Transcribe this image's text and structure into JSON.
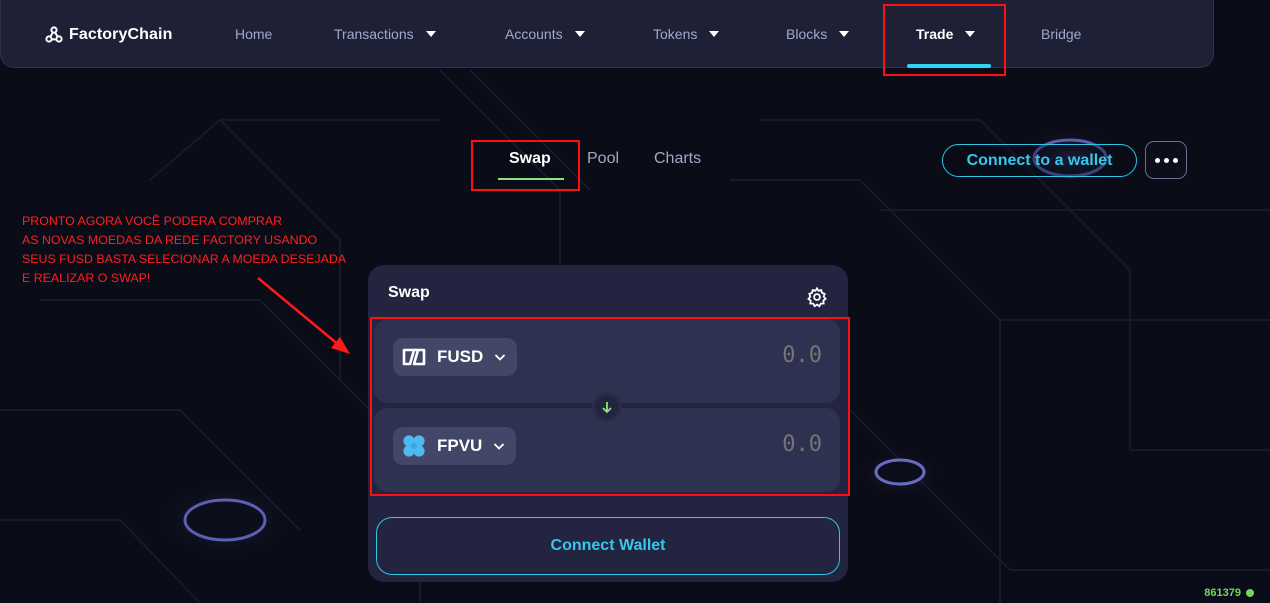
{
  "nav": {
    "logo_text": "FactoryChain",
    "items": [
      {
        "label": "Home",
        "dropdown": false
      },
      {
        "label": "Transactions",
        "dropdown": true
      },
      {
        "label": "Accounts",
        "dropdown": true
      },
      {
        "label": "Tokens",
        "dropdown": true
      },
      {
        "label": "Blocks",
        "dropdown": true
      },
      {
        "label": "Trade",
        "dropdown": true,
        "active": true
      },
      {
        "label": "Bridge",
        "dropdown": false
      }
    ]
  },
  "subtabs": [
    {
      "label": "Swap",
      "active": true
    },
    {
      "label": "Pool",
      "active": false
    },
    {
      "label": "Charts",
      "active": false
    }
  ],
  "header_actions": {
    "connect_label": "Connect to a wallet",
    "more_icon": "ellipsis-icon"
  },
  "annotation": {
    "lines": [
      "PRONTO AGORA VOCÊ PODERA COMPRAR",
      "AS NOVAS MOEDAS DA REDE FACTORY USANDO",
      "SEUS FUSD BASTA SELECIONAR A MOEDA DESEJADA",
      "E REALIZAR O SWAP!"
    ]
  },
  "swap_card": {
    "title": "Swap",
    "settings_icon": "gear-icon",
    "from": {
      "token": "FUSD",
      "amount": "0.0",
      "icon": "fusd-logo-icon"
    },
    "to": {
      "token": "FPVU",
      "amount": "0.0",
      "icon": "fpvu-clover-icon"
    },
    "switch_icon": "arrow-down-icon",
    "connect_label": "Connect Wallet"
  },
  "status": {
    "block_number": "861379"
  },
  "colors": {
    "background": "#0a0c17",
    "nav": "#1e2036",
    "card": "#232540",
    "field": "#2e3150",
    "accent_cyan": "#2fc5e6",
    "accent_green": "#8ee27a",
    "highlight_red": "#ff0f0f",
    "annotation_red": "#ff2020"
  }
}
